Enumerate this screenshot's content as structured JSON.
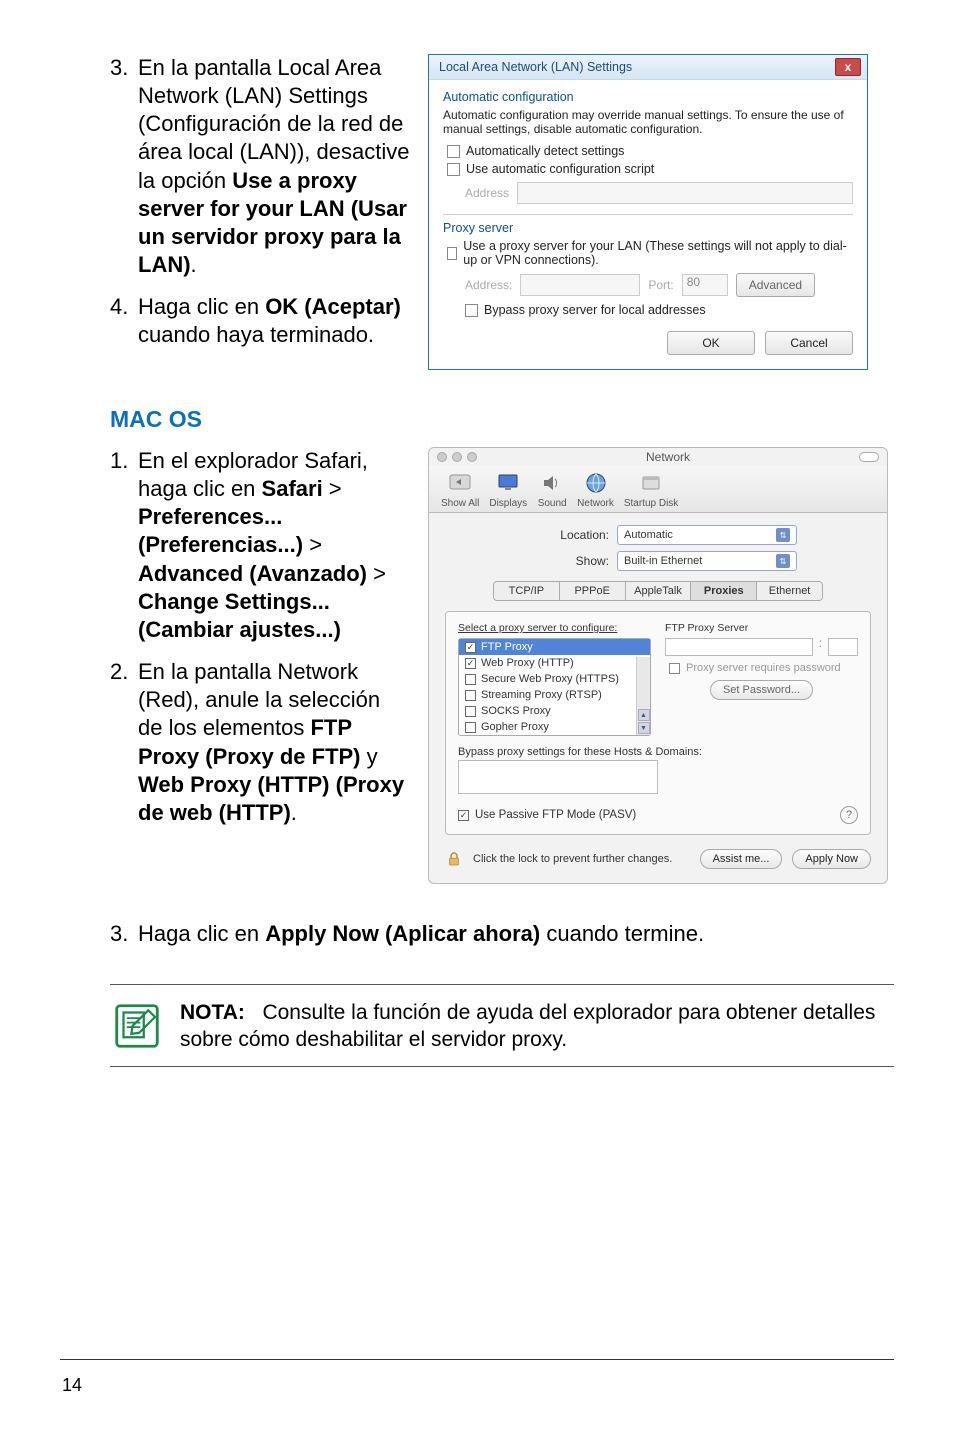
{
  "section1": {
    "items": [
      {
        "num": "3.",
        "text_pre": "En la pantalla Local Area Network (LAN) Settings (Configuración de la red de área local (LAN)), desactive la opción ",
        "bold1": "Use a proxy server for your LAN (Usar un servidor proxy para la LAN)",
        "text_post": "."
      },
      {
        "num": "4.",
        "text_pre": "Haga clic en ",
        "bold1": "OK (Aceptar)",
        "text_post": " cuando haya terminado."
      }
    ]
  },
  "lan": {
    "title": "Local Area Network (LAN) Settings",
    "close": "x",
    "auto_legend": "Automatic configuration",
    "auto_desc": "Automatic configuration may override manual settings.  To ensure the use of manual settings, disable automatic configuration.",
    "chk_auto_detect": "Automatically detect settings",
    "chk_auto_script": "Use automatic configuration script",
    "address_lbl": "Address",
    "proxy_legend": "Proxy server",
    "proxy_desc": "Use a proxy server for your LAN (These settings will not apply to dial-up or VPN connections).",
    "addr2_lbl": "Address:",
    "port_lbl": "Port:",
    "port_val": "80",
    "adv_btn": "Advanced",
    "bypass": "Bypass proxy server for local addresses",
    "ok": "OK",
    "cancel": "Cancel"
  },
  "macos_heading": "MAC OS",
  "section2": {
    "items": [
      {
        "num": "1.",
        "parts": [
          "En el explorador Safari, haga clic en ",
          "Safari",
          " > ",
          "Preferences... (Preferencias...)",
          " > ",
          "Advanced (Avanzado)",
          " > ",
          "Change Settings... (Cambiar ajustes...)"
        ]
      },
      {
        "num": "2.",
        "parts": [
          "En la pantalla Network (Red), anule la selección de los elementos ",
          "FTP Proxy (Proxy de FTP)",
          " y ",
          "Web Proxy (HTTP) (Proxy de web (HTTP)",
          "."
        ]
      }
    ]
  },
  "mac": {
    "title": "Network",
    "toolbar": {
      "showall": "Show All",
      "displays": "Displays",
      "sound": "Sound",
      "network": "Network",
      "startup": "Startup Disk"
    },
    "location_lbl": "Location:",
    "location_val": "Automatic",
    "show_lbl": "Show:",
    "show_val": "Built-in Ethernet",
    "tabs": [
      "TCP/IP",
      "PPPoE",
      "AppleTalk",
      "Proxies",
      "Ethernet"
    ],
    "select_proxy_lbl": "Select a proxy server to configure:",
    "fps_lbl": "FTP Proxy Server",
    "proxy_list": [
      "FTP Proxy",
      "Web Proxy (HTTP)",
      "Secure Web Proxy (HTTPS)",
      "Streaming Proxy (RTSP)",
      "SOCKS Proxy",
      "Gopher Proxy"
    ],
    "req_pw": "Proxy server requires password",
    "set_pw": "Set Password...",
    "bypass_lbl": "Bypass proxy settings for these Hosts & Domains:",
    "pasv": "Use Passive FTP Mode (PASV)",
    "lock_txt": "Click the lock to prevent further changes.",
    "assist": "Assist me...",
    "apply": "Apply Now"
  },
  "step3": {
    "num": "3.",
    "pre": "Haga clic en ",
    "bold": "Apply Now (Aplicar ahora)",
    "post": " cuando termine."
  },
  "note": {
    "label": "NOTA:",
    "text": "Consulte la función de ayuda del explorador para obtener detalles sobre cómo deshabilitar el servidor proxy."
  },
  "page": "14"
}
